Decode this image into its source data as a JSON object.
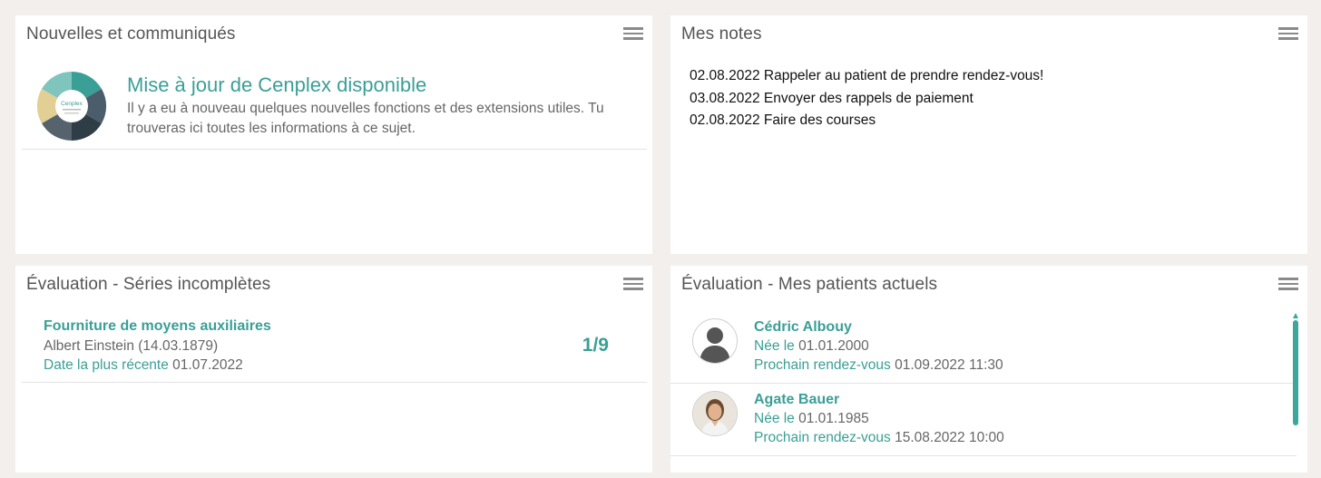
{
  "news": {
    "title": "Nouvelles et communiqués",
    "item_title": "Mise à jour de Cenplex disponible",
    "item_text": "Il y a eu à nouveau quelques nouvelles fonctions et des extensions utiles. Tu trouveras ici toutes les informations à ce sujet.",
    "graphic_label": "Cenplex"
  },
  "notes": {
    "title": "Mes notes",
    "items": [
      "02.08.2022 Rappeler au patient de prendre rendez-vous!",
      "03.08.2022 Envoyer des rappels de paiement",
      "02.08.2022 Faire des courses"
    ]
  },
  "series": {
    "title": "Évaluation - Séries incomplètes",
    "item": {
      "title": "Fourniture de moyens auxiliaires",
      "patient": "Albert Einstein (14.03.1879)",
      "date_label": "Date la plus récente",
      "date_value": "01.07.2022",
      "count": "1/9"
    }
  },
  "patients": {
    "title": "Évaluation - Mes patients actuels",
    "birth_label": "Née le",
    "appt_label": "Prochain rendez-vous",
    "items": [
      {
        "name": "Cédric Albouy",
        "birth": "01.01.2000",
        "appt": "01.09.2022 11:30"
      },
      {
        "name": "Agate Bauer",
        "birth": "01.01.1985",
        "appt": "15.08.2022 10:00"
      }
    ]
  },
  "icons": {
    "menu": "hamburger-menu-icon",
    "placeholder_avatar": "person-silhouette-icon"
  },
  "colors": {
    "accent": "#3a9f96",
    "background": "#f3efec",
    "panel": "#ffffff"
  }
}
